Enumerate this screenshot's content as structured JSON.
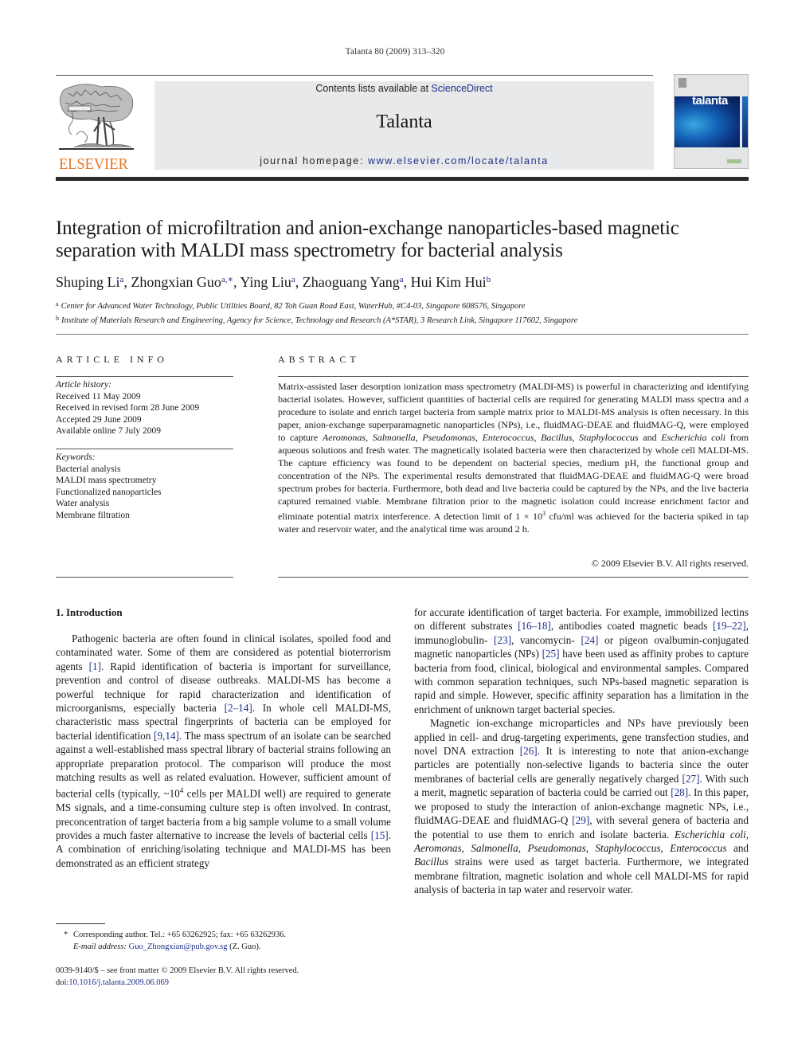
{
  "citation": "Talanta 80 (2009) 313–320",
  "publisher": {
    "logo_text": "ELSEVIER",
    "logo_color": "#e87722"
  },
  "banner": {
    "contents_prefix": "Contents lists available at ",
    "contents_link": "ScienceDirect",
    "journal_title": "Talanta",
    "homepage_prefix": "journal homepage: ",
    "homepage_link": "www.elsevier.com/locate/talanta"
  },
  "cover": {
    "title": "talanta"
  },
  "article": {
    "title": "Integration of microfiltration and anion-exchange nanoparticles-based magnetic separation with MALDI mass spectrometry for bacterial analysis",
    "authors": [
      {
        "name": "Shuping Li",
        "sup": "a"
      },
      {
        "name": "Zhongxian Guo",
        "sup": "a,∗"
      },
      {
        "name": "Ying Liu",
        "sup": "a"
      },
      {
        "name": "Zhaoguang Yang",
        "sup": "a"
      },
      {
        "name": "Hui Kim Hui",
        "sup": "b"
      }
    ],
    "affiliations": [
      {
        "mark": "a",
        "text": "Center for Advanced Water Technology, Public Utilities Board, 82 Toh Guan Road East, WaterHub, #C4-03, Singapore 608576, Singapore"
      },
      {
        "mark": "b",
        "text": "Institute of Materials Research and Engineering, Agency for Science, Technology and Research (A*STAR), 3 Research Link, Singapore 117602, Singapore"
      }
    ]
  },
  "article_info": {
    "heading": "ARTICLE INFO",
    "history_label": "Article history:",
    "history": [
      "Received 11 May 2009",
      "Received in revised form 28 June 2009",
      "Accepted 29 June 2009",
      "Available online 7 July 2009"
    ],
    "keywords_label": "Keywords:",
    "keywords": [
      "Bacterial analysis",
      "MALDI mass spectrometry",
      "Functionalized nanoparticles",
      "Water analysis",
      "Membrane filtration"
    ]
  },
  "abstract": {
    "heading": "ABSTRACT",
    "p1": "Matrix-assisted laser desorption ionization mass spectrometry (MALDI-MS) is powerful in characterizing and identifying bacterial isolates. However, sufficient quantities of bacterial cells are required for generating MALDI mass spectra and a procedure to isolate and enrich target bacteria from sample matrix prior to MALDI-MS analysis is often necessary. In this paper, anion-exchange superparamagnetic nanoparticles (NPs), i.e., fluidMAG-DEAE and fluidMAG-Q, were employed to capture ",
    "sp1": "Aeromonas",
    "sep1": ", ",
    "sp2": "Salmonella",
    "sep2": ", ",
    "sp3": "Pseudomonas",
    "sep3": ", ",
    "sp4": "Enterococcus",
    "sep4": ", ",
    "sp5": "Bacillus",
    "sep5": ", ",
    "sp6": "Staphylococcus",
    "sep6": " and ",
    "sp7": "Escherichia coli",
    "p2": " from aqueous solutions and fresh water. The magnetically isolated bacteria were then characterized by whole cell MALDI-MS. The capture efficiency was found to be dependent on bacterial species, medium pH, the functional group and concentration of the NPs. The experimental results demonstrated that fluidMAG-DEAE and fluidMAG-Q were broad spectrum probes for bacteria. Furthermore, both dead and live bacteria could be captured by the NPs, and the live bacteria captured remained viable. Membrane filtration prior to the magnetic isolation could increase enrichment factor and eliminate potential matrix interference. A detection limit of 1 × 10",
    "exp": "3",
    "p3": " cfu/ml was achieved for the bacteria spiked in tap water and reservoir water, and the analytical time was around 2 h.",
    "copyright": "© 2009 Elsevier B.V. All rights reserved."
  },
  "intro": {
    "heading": "1.  Introduction",
    "left": {
      "a": "Pathogenic bacteria are often found in clinical isolates, spoiled food and contaminated water. Some of them are considered as potential bioterrorism agents ",
      "r1": "[1]",
      "b": ". Rapid identification of bacteria is important for surveillance, prevention and control of disease outbreaks. MALDI-MS has become a powerful technique for rapid characterization and identification of microorganisms, especially bacteria ",
      "r2": "[2–14]",
      "c": ". In whole cell MALDI-MS, characteristic mass spectral fingerprints of bacteria can be employed for bacterial identification ",
      "r3": "[9,14]",
      "d": ". The mass spectrum of an isolate can be searched against a well-established mass spectral library of bacterial strains following an appropriate preparation protocol. The comparison will produce the most matching results as well as related evaluation. However, sufficient amount of bacterial cells (typically, ~10",
      "exp": "4",
      "e": " cells per MALDI well) are required to generate MS signals, and a time-consuming culture step is often involved. In contrast, preconcentration of target bacteria from a big sample volume to a small volume provides a much faster alternative to increase the levels of bacterial cells ",
      "r4": "[15]",
      "f": ". A combination of enriching/isolating technique and MALDI-MS has been demonstrated as an efficient strategy"
    },
    "right": {
      "a": "for accurate identification of target bacteria. For example, immobilized lectins on different substrates ",
      "r1": "[16–18]",
      "b": ", antibodies coated magnetic beads ",
      "r2": "[19–22]",
      "c": ", immunoglobulin- ",
      "r3": "[23]",
      "d": ", vancomycin- ",
      "r4": "[24]",
      "e": " or pigeon ovalbumin-conjugated magnetic nanoparticles (NPs) ",
      "r5": "[25]",
      "f": " have been used as affinity probes to capture bacteria from food, clinical, biological and environmental samples. Compared with common separation techniques, such NPs-based magnetic separation is rapid and simple. However, specific affinity separation has a limitation in the enrichment of unknown target bacterial species.",
      "g": "Magnetic ion-exchange microparticles and NPs have previously been applied in cell- and drug-targeting experiments, gene transfection studies, and novel DNA extraction ",
      "r6": "[26]",
      "h": ". It is interesting to note that anion-exchange particles are potentially non-selective ligands to bacteria since the outer membranes of bacterial cells are generally negatively charged ",
      "r7": "[27]",
      "i": ". With such a merit, magnetic separation of bacteria could be carried out ",
      "r8": "[28]",
      "j": ". In this paper, we proposed to study the interaction of anion-exchange magnetic NPs, i.e., fluidMAG-DEAE and fluidMAG-Q ",
      "r9": "[29]",
      "k": ", with several genera of bacteria and the potential to use them to enrich and isolate bacteria. ",
      "s1": "Escherichia coli",
      "s1sep": ", ",
      "s2": "Aeromonas",
      "s2sep": ", ",
      "s3": "Salmonella",
      "s3sep": ", ",
      "s4": "Pseudomonas",
      "s4sep": ", ",
      "s5": "Staphylococcus",
      "s5sep": ", ",
      "s6": "Enterococcus",
      "s6sep": " and ",
      "s7": "Bacillus",
      "l": " strains were used as target bacteria. Furthermore, we integrated membrane filtration, magnetic isolation and whole cell MALDI-MS for rapid analysis of bacteria in tap water and reservoir water."
    }
  },
  "footnotes": {
    "star": "*",
    "corresponding": "Corresponding author. Tel.: +65 63262925; fax: +65 63262936.",
    "email_label": "E-mail address: ",
    "email": "Guo_Zhongxian@pub.gov.sg",
    "email_suffix": " (Z. Guo).",
    "front_matter": "0039-9140/$ – see front matter © 2009 Elsevier B.V. All rights reserved.",
    "doi_label": "doi:",
    "doi": "10.1016/j.talanta.2009.06.069"
  },
  "colors": {
    "link": "#1f2f8a",
    "banner_bg": "#e8e9ea",
    "elsevier_orange": "#e87722"
  }
}
